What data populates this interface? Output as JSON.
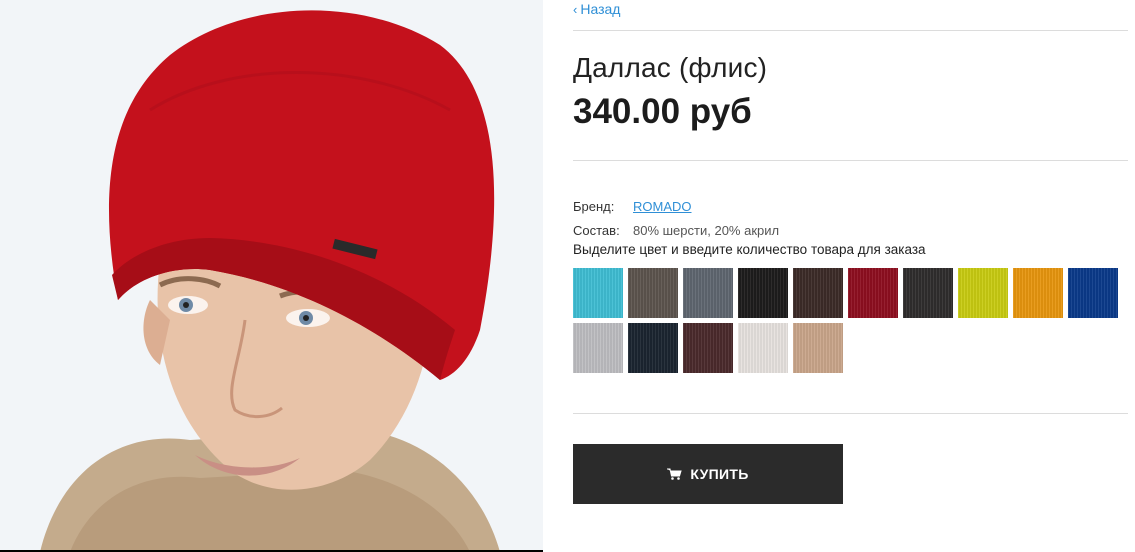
{
  "nav": {
    "back_label": "Назад"
  },
  "product": {
    "title": "Даллас (флис)",
    "price": "340.00 руб",
    "brand_label": "Бренд:",
    "brand_value": "ROMADO",
    "composition_label": "Состав:",
    "composition_value": "80% шерсти, 20% акрил",
    "color_prompt": "Выделите цвет и введите количество товара для заказа"
  },
  "swatches": [
    {
      "name": "swatch-turquoise",
      "color": "#3fbdd3"
    },
    {
      "name": "swatch-taupe",
      "color": "#5d544e"
    },
    {
      "name": "swatch-slate-grey",
      "color": "#5f6670"
    },
    {
      "name": "swatch-black",
      "color": "#1e1c1c"
    },
    {
      "name": "swatch-dark-brown",
      "color": "#3c2b28"
    },
    {
      "name": "swatch-crimson",
      "color": "#8e0f20"
    },
    {
      "name": "swatch-charcoal",
      "color": "#2f2d2d"
    },
    {
      "name": "swatch-lime",
      "color": "#c8cb12"
    },
    {
      "name": "swatch-orange",
      "color": "#e7960f"
    },
    {
      "name": "swatch-royal-blue",
      "color": "#0b3a8a"
    },
    {
      "name": "swatch-light-grey",
      "color": "#bdbdc1"
    },
    {
      "name": "swatch-navy-black",
      "color": "#1b2530"
    },
    {
      "name": "swatch-plum-brown",
      "color": "#4b2a2c"
    },
    {
      "name": "swatch-off-white",
      "color": "#e6e1de"
    },
    {
      "name": "swatch-beige",
      "color": "#c9a58a"
    }
  ],
  "actions": {
    "buy_label": "КУПИТЬ"
  },
  "colors": {
    "link": "#2f8fd6",
    "button_bg": "#2b2b2b",
    "hat": "#c4111c"
  },
  "icons": {
    "back": "chevron-left-icon",
    "cart": "cart-icon"
  }
}
